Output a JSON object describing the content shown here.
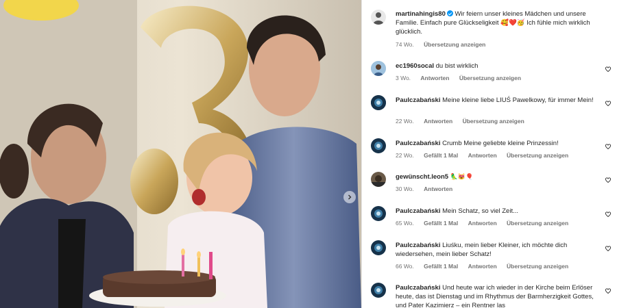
{
  "post": {
    "next_icon": "chevron-right-icon"
  },
  "caption": {
    "username": "martinahingis80",
    "text": "Wir feiern unser kleines Mädchen und unsere Familie. Einfach pure Glückseligkeit 🥰❤️🥳 Ich fühle mich wirklich glücklich.",
    "time": "74 Wo.",
    "translate": "Übersetzung anzeigen"
  },
  "comments": [
    {
      "username": "ec1960socal",
      "text": "du bist wirklich",
      "time": "3 Wo.",
      "likes": "",
      "reply": "Antworten",
      "translate": "Übersetzung anzeigen"
    },
    {
      "username": "Paulczabański",
      "text": "Meine kleine liebe LIUŚ Pawelkowy, für immer Mein!",
      "time": "22 Wo.",
      "likes": "",
      "reply": "Antworten",
      "translate": "Übersetzung anzeigen"
    },
    {
      "username": "Paulczabański",
      "text": "Crumb Meine geliebte kleine Prinzessin!",
      "time": "22 Wo.",
      "likes": "Gefällt 1 Mal",
      "reply": "Antworten",
      "translate": "Übersetzung anzeigen"
    },
    {
      "username": "gewünscht.leon5",
      "text": "🦜😻🎈",
      "time": "30 Wo.",
      "likes": "",
      "reply": "Antworten",
      "translate": ""
    },
    {
      "username": "Paulczabański",
      "text": "Mein Schatz, so viel Zeit...",
      "time": "65 Wo.",
      "likes": "Gefällt 1 Mal",
      "reply": "Antworten",
      "translate": "Übersetzung anzeigen"
    },
    {
      "username": "Paulczabański",
      "text": "Liuśku, mein lieber Kleiner, ich möchte dich wiedersehen, mein lieber Schatz!",
      "time": "66 Wo.",
      "likes": "Gefällt 1 Mal",
      "reply": "Antworten",
      "translate": "Übersetzung anzeigen"
    },
    {
      "username": "Paulczabański",
      "text": "Und heute war ich wieder in der Kirche beim Erlöser heute, das ist Dienstag und im Rhythmus der Barmherzigkeit Gottes, und Pater Kazimierz – ein Rentner las",
      "time": "",
      "likes": "",
      "reply": "",
      "translate": ""
    }
  ],
  "icons": {
    "heart": "heart-outline-icon"
  },
  "colors": {
    "verified": "#0095f6",
    "meta": "#737373",
    "text": "#262626"
  }
}
